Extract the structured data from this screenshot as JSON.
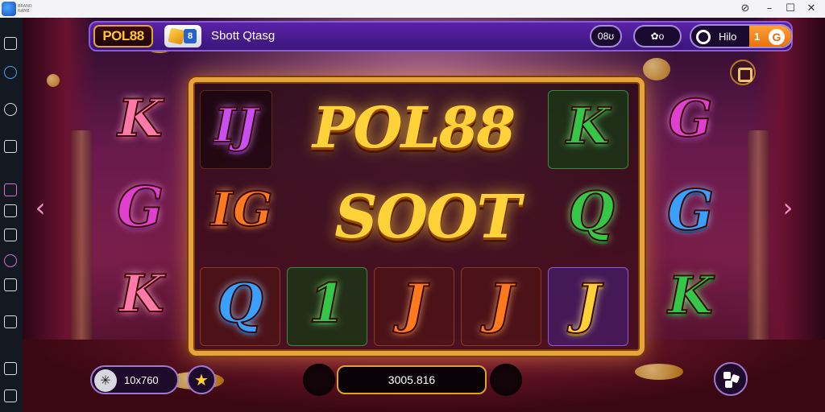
{
  "window": {
    "app_logo_text": "BRAND NAME",
    "min_glyph": "–",
    "max_glyph": "☐",
    "close_glyph": "✕",
    "extra_glyph": "⊘"
  },
  "hud": {
    "logo": "POL88",
    "game_icon_badge": "8",
    "title": "Sbott Qtasg",
    "pill_a": "08ʊ",
    "pill_b": "✿o",
    "hello": "Hilo",
    "orange_num": "1",
    "orange_g": "G"
  },
  "reels": {
    "banner_top": "POL88",
    "banner_mid": "SOOT",
    "row1": [
      "IJ",
      "K"
    ],
    "row2": [
      "IG",
      "Q"
    ],
    "row3": [
      "Q",
      "1",
      "J",
      "J",
      "J"
    ],
    "side_left": [
      "K",
      "G",
      "K"
    ],
    "side_right": [
      "G",
      "G",
      "K"
    ]
  },
  "nav": {
    "left": "‹",
    "right": "›"
  },
  "bottom": {
    "bet_icon": "✳",
    "bet_value": "10x760",
    "fav_icon": "★",
    "balance": "3005.816"
  },
  "colors": {
    "accent_gold": "#e8a43c",
    "hud_purple": "#5a22a8",
    "orange": "#ffa033"
  }
}
